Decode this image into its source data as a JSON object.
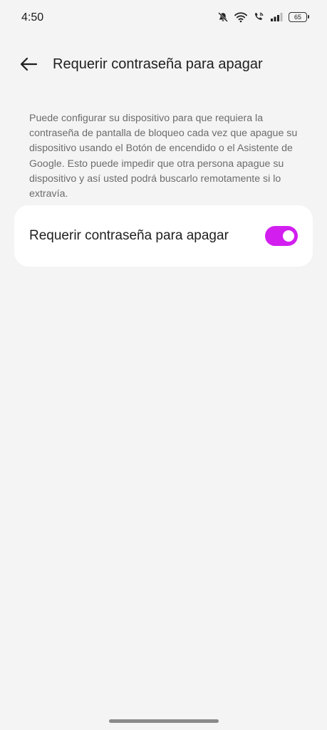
{
  "status_bar": {
    "time": "4:50",
    "battery_level": "65",
    "icons": [
      "bell-off-icon",
      "wifi-icon",
      "wifi-calling-icon",
      "signal-icon",
      "battery-icon"
    ]
  },
  "header": {
    "back_icon": "arrow-left-icon",
    "title": "Requerir contraseña para apagar"
  },
  "description": "Puede configurar su dispositivo para que requiera la contraseña de pantalla de bloqueo cada vez que apague su dispositivo usando el Botón de encendido o el Asistente de Google. Esto puede impedir que otra persona apague su dispositivo y así usted podrá buscarlo remotamente si lo extravía.",
  "setting": {
    "label": "Requerir contraseña para apagar",
    "toggle_on": true
  },
  "colors": {
    "background": "#f4f4f4",
    "card": "#ffffff",
    "accent": "#d21ff0",
    "description_text": "#6c6c6c"
  }
}
